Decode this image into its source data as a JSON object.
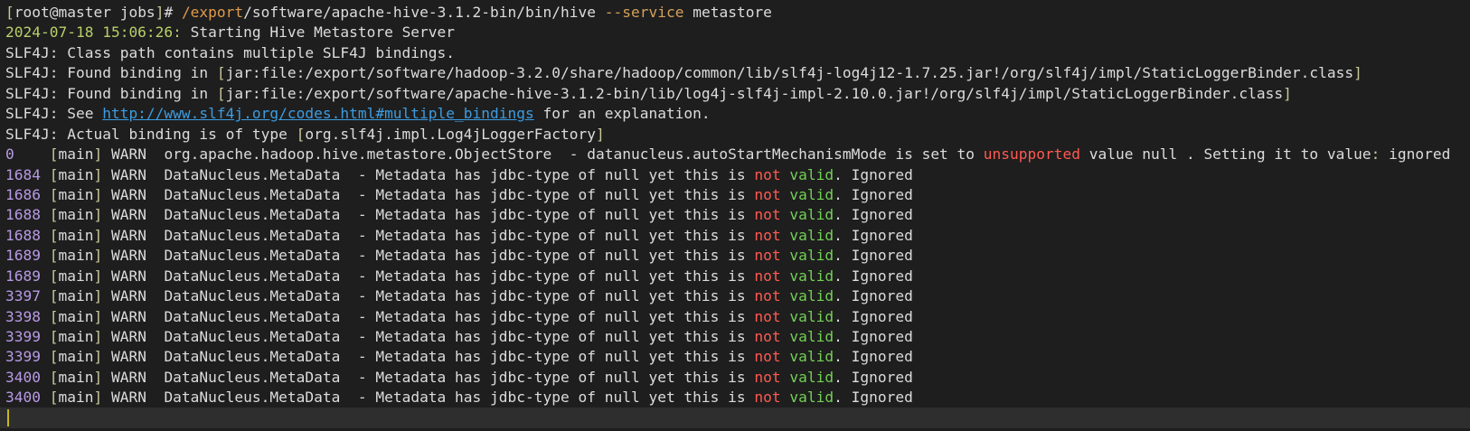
{
  "terminal": {
    "lines": [
      [
        [
          "[",
          "brk"
        ],
        [
          "root@master jobs",
          "default"
        ],
        [
          "]",
          "brk"
        ],
        [
          "# ",
          "default"
        ],
        [
          "/export",
          "path"
        ],
        [
          "/software/apache-hive-3.1.2-bin/bin/hive ",
          "default"
        ],
        [
          "--service",
          "opt"
        ],
        [
          " metastore",
          "default"
        ]
      ],
      [
        [
          "2024-07-18 15:06:26:",
          "ts"
        ],
        [
          " Starting Hive Metastore Server",
          "default"
        ]
      ],
      [
        [
          "SLF4J: Class path contains multiple SLF4J bindings.",
          "default"
        ]
      ],
      [
        [
          "SLF4J: Found binding in ",
          "default"
        ],
        [
          "[",
          "brk"
        ],
        [
          "jar:file:/export/software/hadoop-3.2.0/share/hadoop/common/lib/slf4j-log4j12-1.7.25.jar!/org/slf4j/impl/StaticLoggerBinder.class",
          "default"
        ],
        [
          "]",
          "brk"
        ]
      ],
      [
        [
          "SLF4J: Found binding in ",
          "default"
        ],
        [
          "[",
          "brk"
        ],
        [
          "jar:file:/export/software/apache-hive-3.1.2-bin/lib/log4j-slf4j-impl-2.10.0.jar!/org/slf4j/impl/StaticLoggerBinder.class",
          "default"
        ],
        [
          "]",
          "brk"
        ]
      ],
      [
        [
          "SLF4J: See ",
          "default"
        ],
        [
          "http://www.slf4j.org/codes.html#multiple_bindings",
          "link"
        ],
        [
          " for an explanation.",
          "default"
        ]
      ],
      [
        [
          "SLF4J: Actual binding is of type ",
          "default"
        ],
        [
          "[",
          "brk"
        ],
        [
          "org.slf4j.impl.Log4jLoggerFactory",
          "default"
        ],
        [
          "]",
          "brk"
        ]
      ],
      [
        [
          "0",
          "num"
        ],
        [
          "    ",
          "default"
        ],
        [
          "[",
          "brk"
        ],
        [
          "main",
          "default"
        ],
        [
          "]",
          "brk"
        ],
        [
          " WARN  org.apache.hadoop.hive.metastore.ObjectStore  - datanucleus.autoStartMechanismMode is set to ",
          "default"
        ],
        [
          "unsupported",
          "red"
        ],
        [
          " value null . Setting it to value",
          "default"
        ],
        [
          ":",
          "colon"
        ],
        [
          " ignored",
          "default"
        ]
      ],
      [
        [
          "1684",
          "num"
        ],
        [
          " ",
          "default"
        ],
        [
          "[",
          "brk"
        ],
        [
          "main",
          "default"
        ],
        [
          "]",
          "brk"
        ],
        [
          " WARN  DataNucleus.MetaData  - Metadata has jdbc-type of null yet this is ",
          "default"
        ],
        [
          "not",
          "red"
        ],
        [
          " ",
          "default"
        ],
        [
          "valid",
          "green"
        ],
        [
          ". Ignored",
          "default"
        ]
      ],
      [
        [
          "1686",
          "num"
        ],
        [
          " ",
          "default"
        ],
        [
          "[",
          "brk"
        ],
        [
          "main",
          "default"
        ],
        [
          "]",
          "brk"
        ],
        [
          " WARN  DataNucleus.MetaData  - Metadata has jdbc-type of null yet this is ",
          "default"
        ],
        [
          "not",
          "red"
        ],
        [
          " ",
          "default"
        ],
        [
          "valid",
          "green"
        ],
        [
          ". Ignored",
          "default"
        ]
      ],
      [
        [
          "1688",
          "num"
        ],
        [
          " ",
          "default"
        ],
        [
          "[",
          "brk"
        ],
        [
          "main",
          "default"
        ],
        [
          "]",
          "brk"
        ],
        [
          " WARN  DataNucleus.MetaData  - Metadata has jdbc-type of null yet this is ",
          "default"
        ],
        [
          "not",
          "red"
        ],
        [
          " ",
          "default"
        ],
        [
          "valid",
          "green"
        ],
        [
          ". Ignored",
          "default"
        ]
      ],
      [
        [
          "1688",
          "num"
        ],
        [
          " ",
          "default"
        ],
        [
          "[",
          "brk"
        ],
        [
          "main",
          "default"
        ],
        [
          "]",
          "brk"
        ],
        [
          " WARN  DataNucleus.MetaData  - Metadata has jdbc-type of null yet this is ",
          "default"
        ],
        [
          "not",
          "red"
        ],
        [
          " ",
          "default"
        ],
        [
          "valid",
          "green"
        ],
        [
          ". Ignored",
          "default"
        ]
      ],
      [
        [
          "1689",
          "num"
        ],
        [
          " ",
          "default"
        ],
        [
          "[",
          "brk"
        ],
        [
          "main",
          "default"
        ],
        [
          "]",
          "brk"
        ],
        [
          " WARN  DataNucleus.MetaData  - Metadata has jdbc-type of null yet this is ",
          "default"
        ],
        [
          "not",
          "red"
        ],
        [
          " ",
          "default"
        ],
        [
          "valid",
          "green"
        ],
        [
          ". Ignored",
          "default"
        ]
      ],
      [
        [
          "1689",
          "num"
        ],
        [
          " ",
          "default"
        ],
        [
          "[",
          "brk"
        ],
        [
          "main",
          "default"
        ],
        [
          "]",
          "brk"
        ],
        [
          " WARN  DataNucleus.MetaData  - Metadata has jdbc-type of null yet this is ",
          "default"
        ],
        [
          "not",
          "red"
        ],
        [
          " ",
          "default"
        ],
        [
          "valid",
          "green"
        ],
        [
          ". Ignored",
          "default"
        ]
      ],
      [
        [
          "3397",
          "num"
        ],
        [
          " ",
          "default"
        ],
        [
          "[",
          "brk"
        ],
        [
          "main",
          "default"
        ],
        [
          "]",
          "brk"
        ],
        [
          " WARN  DataNucleus.MetaData  - Metadata has jdbc-type of null yet this is ",
          "default"
        ],
        [
          "not",
          "red"
        ],
        [
          " ",
          "default"
        ],
        [
          "valid",
          "green"
        ],
        [
          ". Ignored",
          "default"
        ]
      ],
      [
        [
          "3398",
          "num"
        ],
        [
          " ",
          "default"
        ],
        [
          "[",
          "brk"
        ],
        [
          "main",
          "default"
        ],
        [
          "]",
          "brk"
        ],
        [
          " WARN  DataNucleus.MetaData  - Metadata has jdbc-type of null yet this is ",
          "default"
        ],
        [
          "not",
          "red"
        ],
        [
          " ",
          "default"
        ],
        [
          "valid",
          "green"
        ],
        [
          ". Ignored",
          "default"
        ]
      ],
      [
        [
          "3399",
          "num"
        ],
        [
          " ",
          "default"
        ],
        [
          "[",
          "brk"
        ],
        [
          "main",
          "default"
        ],
        [
          "]",
          "brk"
        ],
        [
          " WARN  DataNucleus.MetaData  - Metadata has jdbc-type of null yet this is ",
          "default"
        ],
        [
          "not",
          "red"
        ],
        [
          " ",
          "default"
        ],
        [
          "valid",
          "green"
        ],
        [
          ". Ignored",
          "default"
        ]
      ],
      [
        [
          "3399",
          "num"
        ],
        [
          " ",
          "default"
        ],
        [
          "[",
          "brk"
        ],
        [
          "main",
          "default"
        ],
        [
          "]",
          "brk"
        ],
        [
          " WARN  DataNucleus.MetaData  - Metadata has jdbc-type of null yet this is ",
          "default"
        ],
        [
          "not",
          "red"
        ],
        [
          " ",
          "default"
        ],
        [
          "valid",
          "green"
        ],
        [
          ". Ignored",
          "default"
        ]
      ],
      [
        [
          "3400",
          "num"
        ],
        [
          " ",
          "default"
        ],
        [
          "[",
          "brk"
        ],
        [
          "main",
          "default"
        ],
        [
          "]",
          "brk"
        ],
        [
          " WARN  DataNucleus.MetaData  - Metadata has jdbc-type of null yet this is ",
          "default"
        ],
        [
          "not",
          "red"
        ],
        [
          " ",
          "default"
        ],
        [
          "valid",
          "green"
        ],
        [
          ". Ignored",
          "default"
        ]
      ],
      [
        [
          "3400",
          "num"
        ],
        [
          " ",
          "default"
        ],
        [
          "[",
          "brk"
        ],
        [
          "main",
          "default"
        ],
        [
          "]",
          "brk"
        ],
        [
          " WARN  DataNucleus.MetaData  - Metadata has jdbc-type of null yet this is ",
          "default"
        ],
        [
          "not",
          "red"
        ],
        [
          " ",
          "default"
        ],
        [
          "valid",
          "green"
        ],
        [
          ". Ignored",
          "default"
        ]
      ]
    ]
  },
  "colors": {
    "background": "#1e1e1e",
    "text": "#dcdcdc",
    "bracket": "#c8c89a",
    "path": "#e09a4a",
    "option": "#d4a05a",
    "timestamp": "#b8cf6a",
    "link": "#3d9ce0",
    "number": "#b89ae6",
    "red": "#ff5a50",
    "green": "#73cf55",
    "cursor": "#c8b420"
  }
}
